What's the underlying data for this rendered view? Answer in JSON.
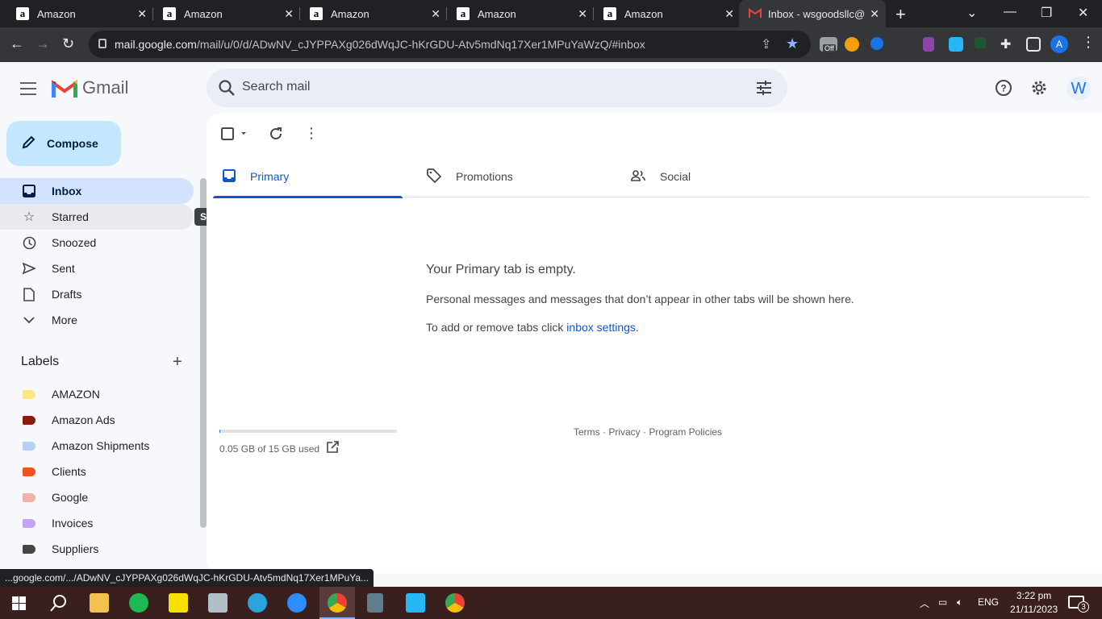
{
  "browser": {
    "tabs": [
      {
        "title": "Amazon",
        "favicon": "a"
      },
      {
        "title": "Amazon",
        "favicon": "a"
      },
      {
        "title": "Amazon",
        "favicon": "a"
      },
      {
        "title": "Amazon",
        "favicon": "a"
      },
      {
        "title": "Amazon",
        "favicon": "a"
      },
      {
        "title": "Inbox - wsgoodsllc@",
        "favicon": "gmail-icon"
      }
    ],
    "url_domain": "mail.google.com",
    "url_path": "/mail/u/0/d/ADwNV_cJYPPAXg026dWqJC-hKrGDU-Atv5mdNq17Xer1MPuYaWzQ/#inbox",
    "profile_initial": "A",
    "ext_off_badge": "Off"
  },
  "gmail": {
    "logo_text": "Gmail",
    "search_placeholder": "Search mail",
    "avatar_initial": "W",
    "compose_label": "Compose",
    "nav": [
      {
        "label": "Inbox",
        "icon": "inbox-icon"
      },
      {
        "label": "Starred",
        "icon": "star-icon"
      },
      {
        "label": "Snoozed",
        "icon": "clock-icon"
      },
      {
        "label": "Sent",
        "icon": "send-icon"
      },
      {
        "label": "Drafts",
        "icon": "draft-icon"
      },
      {
        "label": "More",
        "icon": "chevron-down-icon"
      }
    ],
    "tooltip": "Starred",
    "labels_heading": "Labels",
    "labels": [
      {
        "name": "AMAZON",
        "color": "#fde68a"
      },
      {
        "name": "Amazon Ads",
        "color": "#8a1c0e"
      },
      {
        "name": "Amazon Shipments",
        "color": "#b6cff5"
      },
      {
        "name": "Clients",
        "color": "#f4511e"
      },
      {
        "name": "Google",
        "color": "#f2b2a8"
      },
      {
        "name": "Invoices",
        "color": "#c6a4f5"
      },
      {
        "name": "Suppliers",
        "color": "#444746"
      }
    ],
    "tabs": [
      {
        "label": "Primary",
        "icon": "inbox-icon"
      },
      {
        "label": "Promotions",
        "icon": "tag-icon"
      },
      {
        "label": "Social",
        "icon": "people-icon"
      }
    ],
    "empty_title": "Your Primary tab is empty.",
    "empty_text": "Personal messages and messages that don’t appear in other tabs will be shown here.",
    "empty_text2_prefix": "To add or remove tabs click ",
    "empty_text2_link": "inbox settings",
    "empty_text2_suffix": ".",
    "storage_text": "0.05 GB of 15 GB used",
    "storage_fraction": 0.0033,
    "footer": "Terms · Privacy · Program Policies"
  },
  "status_url": "...google.com/.../ADwNV_cJYPPAXg026dWqJC-hKrGDU-Atv5mdNq17Xer1MPuYa...",
  "taskbar": {
    "lang": "ENG",
    "time": "3:22 pm",
    "date": "21/11/2023",
    "notifications": "3"
  }
}
